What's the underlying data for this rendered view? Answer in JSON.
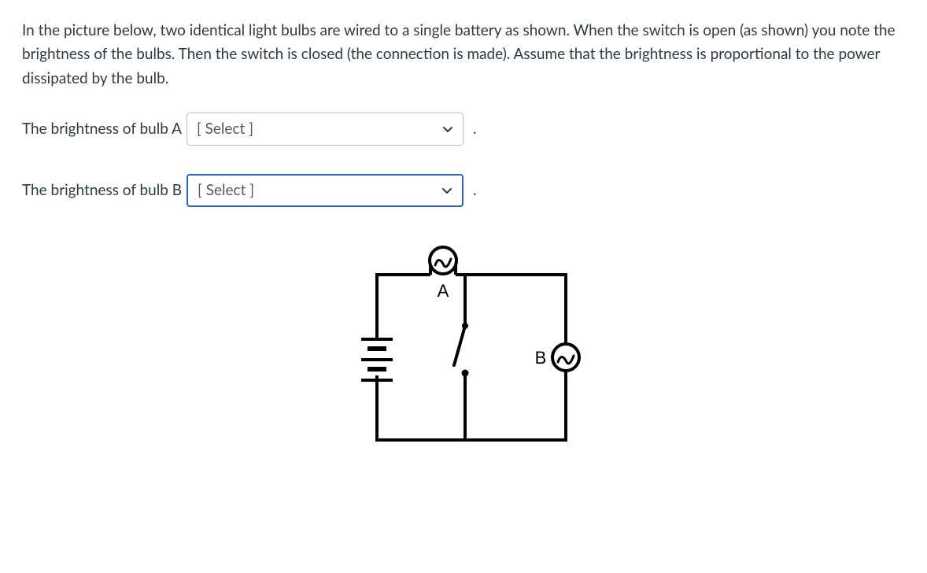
{
  "intro": "In the picture below, two identical light bulbs are wired to a single battery as shown.  When the switch is open (as shown) you note the brightness of the bulbs.  Then the switch is closed (the connection is made).  Assume that the brightness is proportional to the power dissipated by the bulb.",
  "rowA": {
    "label": "The brightness of bulb A",
    "placeholder": "[ Select ]",
    "period": "."
  },
  "rowB": {
    "label": "The brightness of bulb B",
    "placeholder": "[ Select ]",
    "period": "."
  },
  "diagram": {
    "bulbA_label": "A",
    "bulbB_label": "B"
  }
}
